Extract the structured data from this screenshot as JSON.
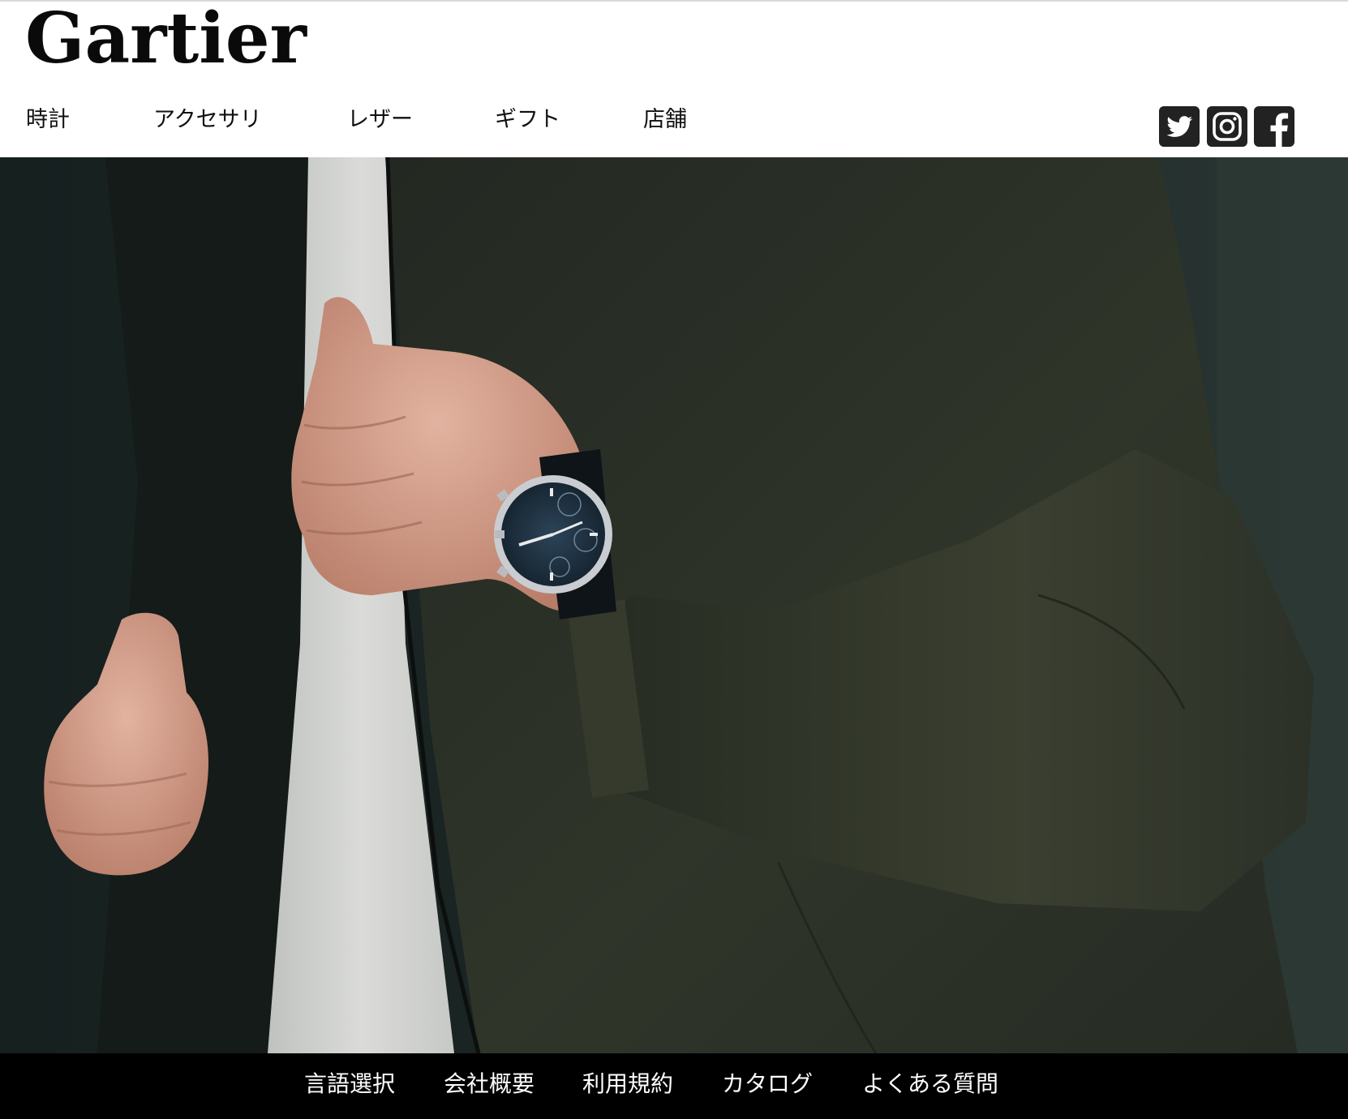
{
  "header": {
    "logo": "Gartier",
    "nav": [
      {
        "label": "時計"
      },
      {
        "label": "アクセサリ"
      },
      {
        "label": "レザー"
      },
      {
        "label": "ギフト"
      },
      {
        "label": "店舗"
      }
    ],
    "social": [
      {
        "icon": "twitter-icon"
      },
      {
        "icon": "instagram-icon"
      },
      {
        "icon": "facebook-icon"
      }
    ]
  },
  "hero": {
    "image": "man-in-dark-green-jacket-wearing-chronograph-wristwatch",
    "colors": {
      "background": "#1f2a29",
      "jacket": "#2b3128",
      "shirt": "#d8d9d6",
      "skin": "#d9a38e",
      "watch_dial": "#1f3447",
      "watch_case": "#c9cdd1"
    }
  },
  "footer": {
    "links": [
      {
        "label": "言語選択"
      },
      {
        "label": "会社概要"
      },
      {
        "label": "利用規約"
      },
      {
        "label": "カタログ"
      },
      {
        "label": "よくある質問"
      }
    ]
  },
  "colors": {
    "header_bg": "#ffffff",
    "text": "#111111",
    "footer_bg": "#000000",
    "footer_text": "#ffffff",
    "icon_bg": "#222222"
  }
}
